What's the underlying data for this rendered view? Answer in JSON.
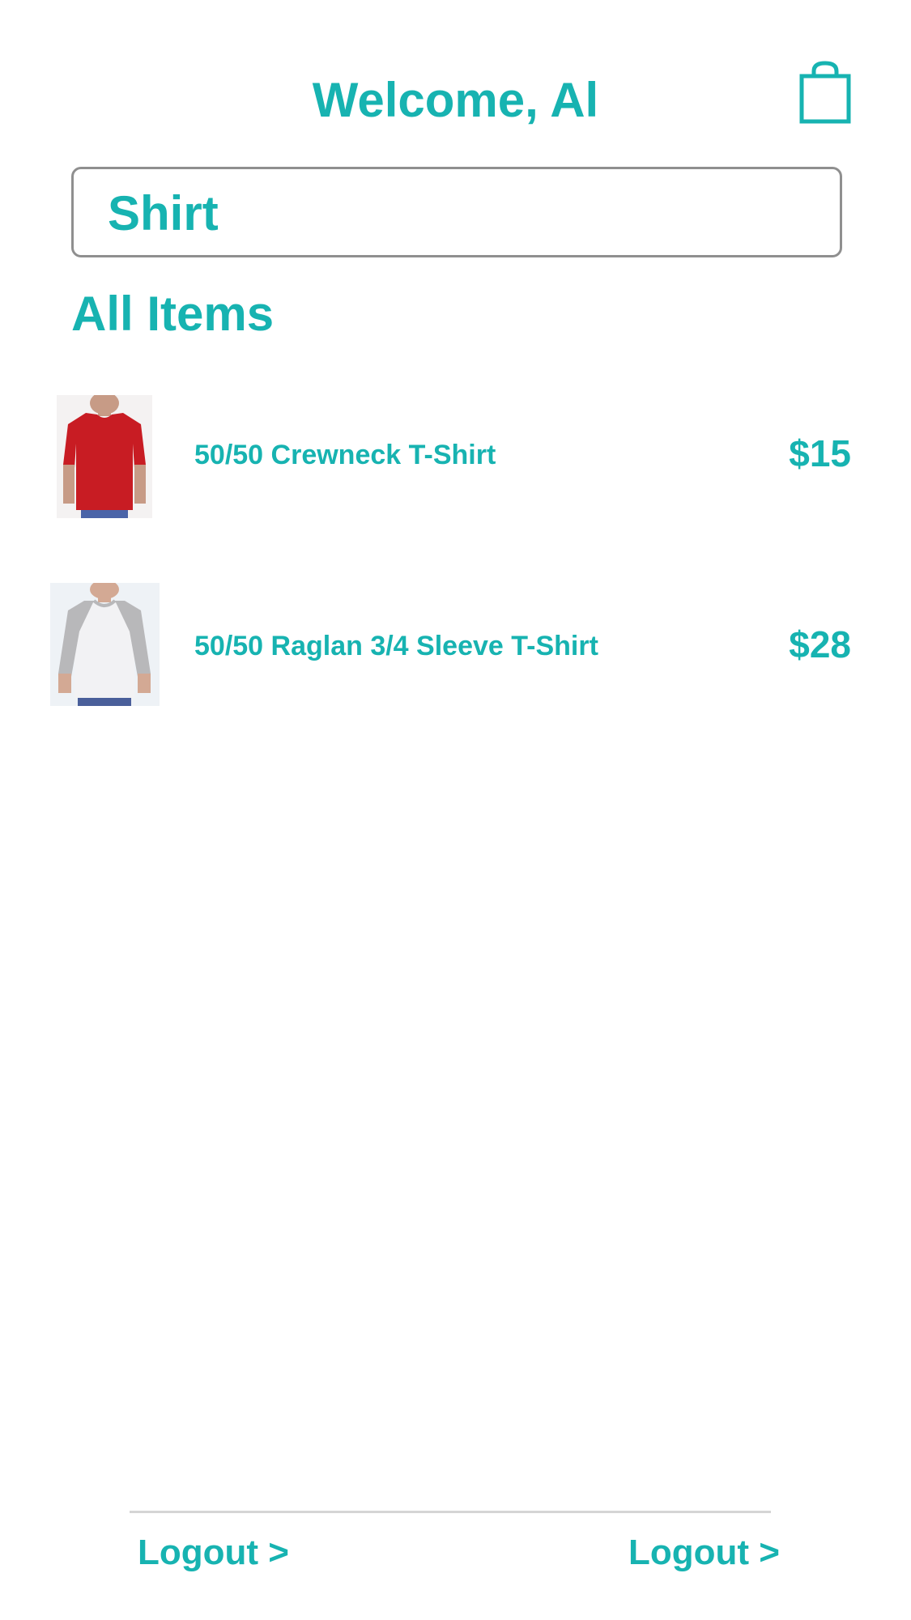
{
  "header": {
    "title": "Welcome, Al",
    "cart_icon": "shopping-bag-icon"
  },
  "search": {
    "value": "Shirt",
    "placeholder": ""
  },
  "section": {
    "heading": "All Items"
  },
  "items": [
    {
      "name": "50/50 Crewneck T-Shirt",
      "price": "$15",
      "image": "red-crewneck-tshirt"
    },
    {
      "name": "50/50 Raglan 3/4 Sleeve T-Shirt",
      "price": "$28",
      "image": "grey-white-raglan-tshirt"
    }
  ],
  "footer": {
    "left_link": "Logout >",
    "right_link": "Logout >"
  },
  "colors": {
    "accent": "#17b3b1",
    "border": "#8f8f8f",
    "divider": "#d5d5d5",
    "background": "#ffffff"
  }
}
